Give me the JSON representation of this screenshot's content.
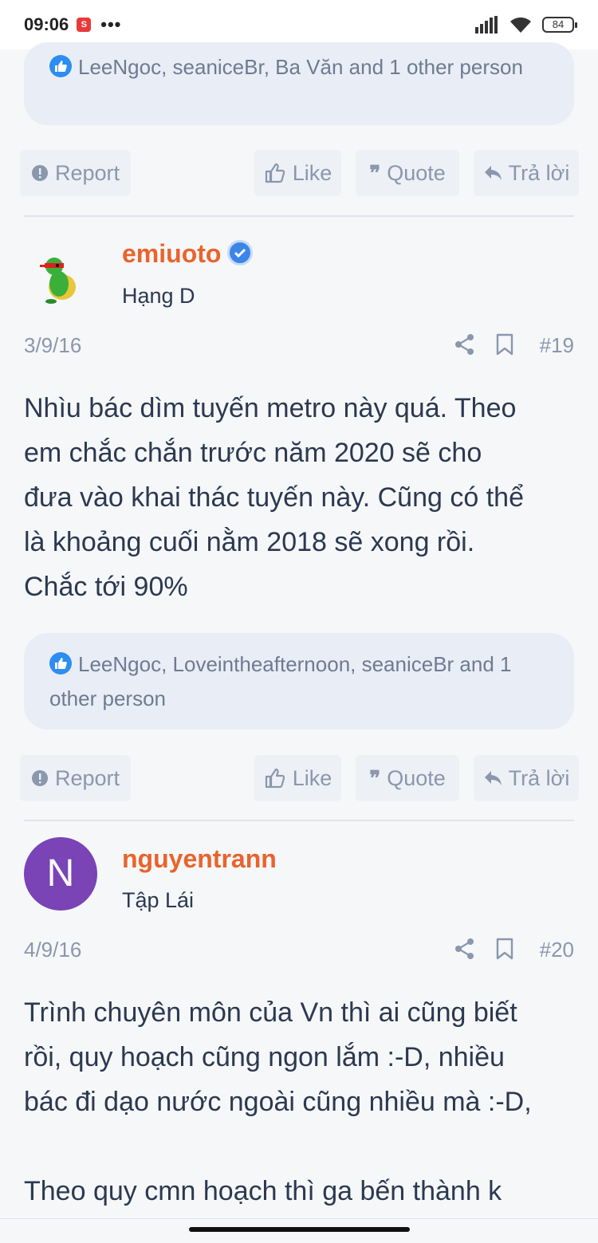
{
  "status": {
    "time": "09:06",
    "battery": "84",
    "dots": "•••"
  },
  "post18": {
    "reactions": "LeeNgoc, seaniceBr, Ba Văn and 1 other person"
  },
  "actions": {
    "report": "Report",
    "like": "Like",
    "quote": "Quote",
    "reply": "Trả lời"
  },
  "post19": {
    "author": "emiuoto",
    "rank": "Hạng D",
    "date": "3/9/16",
    "number": "#19",
    "body_lines": [
      "Nhìu bác dìm tuyến metro này quá. Theo",
      "em chắc chắn trước năm 2020 sẽ cho",
      "đưa vào khai thác tuyến này. Cũng có thể",
      "là khoảng cuối nằm 2018 sẽ xong rồi.",
      "Chắc tới 90%"
    ],
    "reactions": "LeeNgoc, Loveintheafternoon, seaniceBr and 1 other person"
  },
  "post20": {
    "author": "nguyentrann",
    "avatar_letter": "N",
    "rank": "Tập Lái",
    "date": "4/9/16",
    "number": "#20",
    "body_lines": [
      "Trình chuyên môn của Vn thì ai cũng biết",
      "rồi, quy hoạch cũng ngon lắm :-D, nhiều",
      "bác đi dạo nước ngoài cũng nhiều mà :-D,",
      "",
      "Theo quy cmn hoạch thì ga bến thành k"
    ]
  },
  "colors": {
    "author": "#e8642c",
    "text": "#2b3950",
    "muted": "#8a97ad",
    "accent": "#2d8df0"
  }
}
